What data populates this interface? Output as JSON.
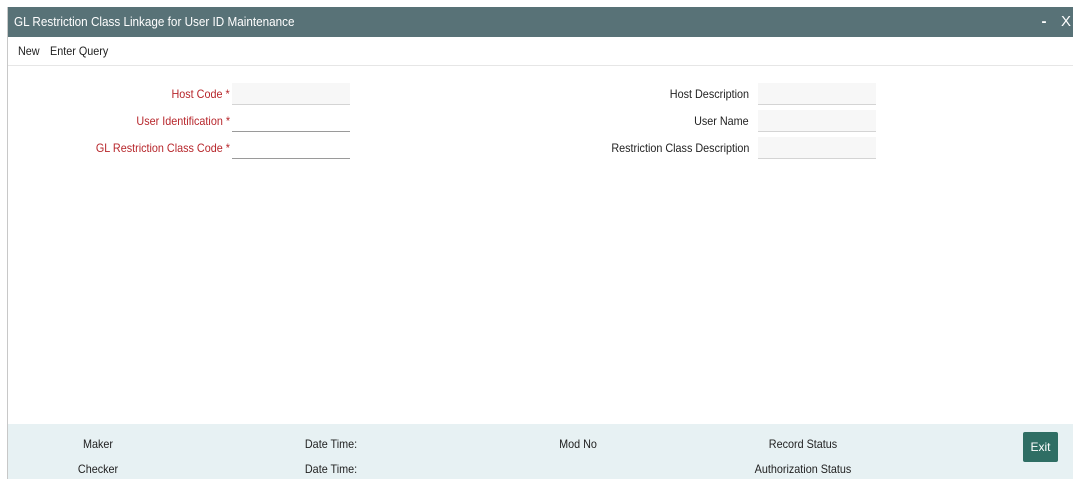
{
  "window": {
    "title": "GL Restriction Class Linkage for User ID Maintenance",
    "minimize_glyph": "-",
    "close_glyph": "X"
  },
  "toolbar": {
    "new_label": "New",
    "enter_query_label": "Enter Query"
  },
  "form": {
    "host_code_label": "Host Code *",
    "host_code_value": "",
    "user_identification_label": "User Identification *",
    "user_identification_value": "",
    "gl_restriction_class_code_label": "GL Restriction Class Code *",
    "gl_restriction_class_code_value": "",
    "host_description_label": "Host Description",
    "host_description_value": "",
    "user_name_label": "User Name",
    "user_name_value": "",
    "restriction_class_description_label": "Restriction Class Description",
    "restriction_class_description_value": ""
  },
  "footer": {
    "maker_label": "Maker",
    "checker_label": "Checker",
    "date_time_label_1": "Date Time:",
    "date_time_label_2": "Date Time:",
    "mod_no_label": "Mod No",
    "record_status_label": "Record Status",
    "authorization_status_label": "Authorization Status",
    "exit_label": "Exit"
  },
  "colors": {
    "titlebar": "#587277",
    "required_label": "#b7262b",
    "footer_bg": "#e7f1f3",
    "exit_button": "#2f6e64"
  }
}
